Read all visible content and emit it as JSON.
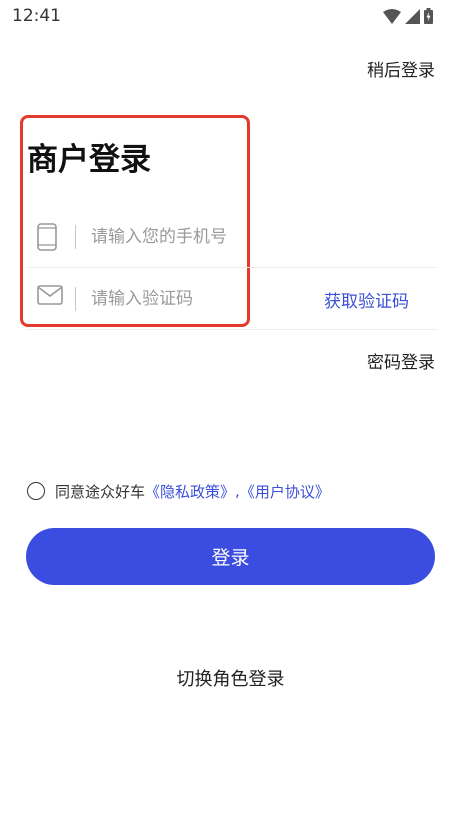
{
  "status_bar": {
    "time": "12:41"
  },
  "header": {
    "later_login": "稍后登录"
  },
  "form": {
    "title": "商户登录",
    "phone_placeholder": "请输入您的手机号",
    "code_placeholder": "请输入验证码",
    "get_code": "获取验证码",
    "password_login": "密码登录"
  },
  "agreement": {
    "prefix": "同意途众好车",
    "privacy": "《隐私政策》",
    "separator": ",",
    "terms": "《用户协议》"
  },
  "actions": {
    "login": "登录",
    "switch_role": "切换角色登录"
  },
  "colors": {
    "accent": "#3b4de0",
    "highlight": "#e23b2e"
  }
}
